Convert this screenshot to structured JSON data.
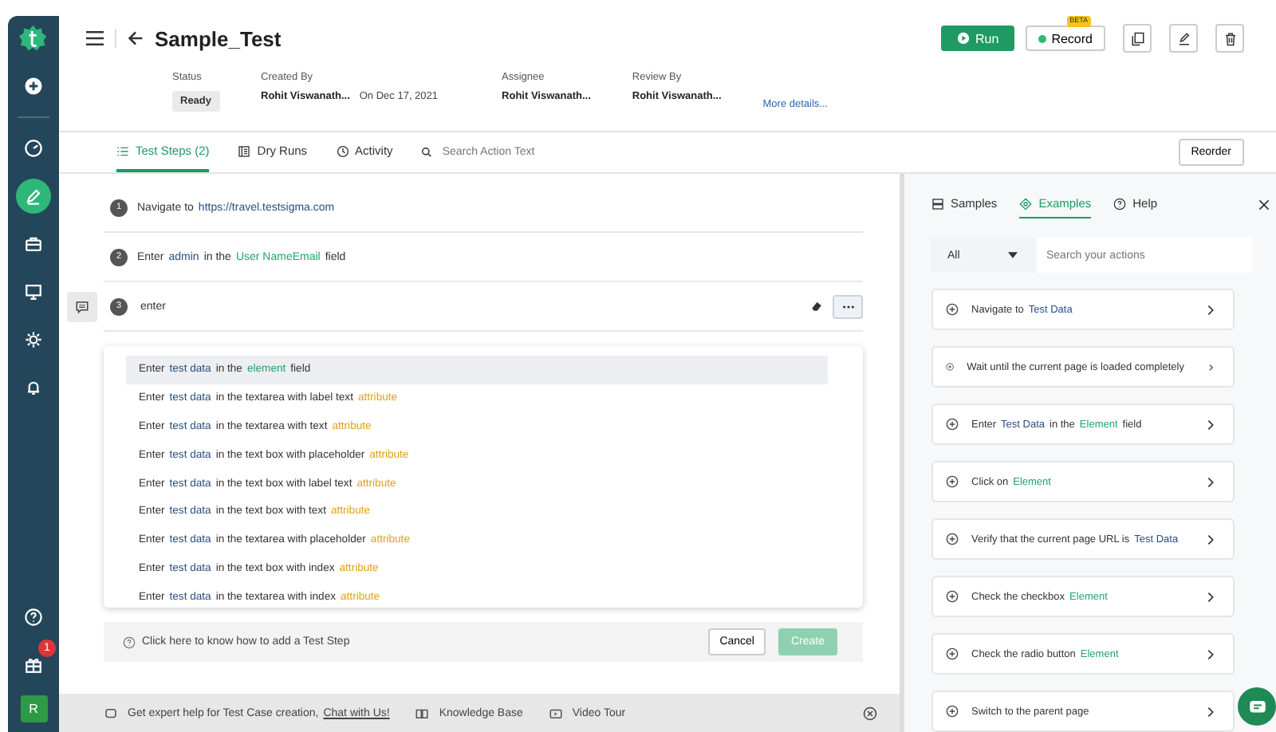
{
  "sidebar": {
    "items": [
      {
        "selected": false
      },
      {
        "selected": false
      },
      {
        "selected": true
      },
      {
        "selected": false
      },
      {
        "selected": false
      },
      {
        "selected": false
      },
      {
        "selected": false
      }
    ],
    "bottom_items": [
      {
        "selected": false
      },
      {
        "selected": false,
        "badge": "1"
      }
    ],
    "avatar": "R"
  },
  "header": {
    "title": "Sample_Test",
    "meta": [
      {
        "label": "Status",
        "value": "Ready",
        "kind": "badge"
      },
      {
        "label": "Created By",
        "value": "Rohit Viswanath...",
        "extra": "On Dec 17, 2021",
        "kind": "text"
      },
      {
        "label": "Assignee",
        "value": "Rohit Viswanath...",
        "kind": "text"
      },
      {
        "label": "Review By",
        "value": "Rohit Viswanath...",
        "kind": "text"
      }
    ],
    "more_link": "More details...",
    "run": "Run",
    "record": "Record",
    "record_badge": "BETA"
  },
  "tabs": [
    {
      "label": "Test Steps (2)",
      "selected": true
    },
    {
      "label": "Dry Runs",
      "selected": false
    },
    {
      "label": "Activity",
      "selected": false
    }
  ],
  "search": {
    "placeholder": "Search Action Text"
  },
  "reorder": "Reorder",
  "steps": [
    {
      "number": "1",
      "kind": "step",
      "parts": [
        {
          "text": "Navigate to",
          "kind": "plain"
        },
        {
          "text": "https://travel.testsigma.com",
          "kind": "data"
        }
      ]
    },
    {
      "number": "2",
      "kind": "step",
      "parts": [
        {
          "text": "Enter",
          "kind": "plain"
        },
        {
          "text": "admin",
          "kind": "data"
        },
        {
          "text": "in the",
          "kind": "plain"
        },
        {
          "text": "User NameEmail",
          "kind": "element"
        },
        {
          "text": "field",
          "kind": "plain"
        }
      ]
    },
    {
      "number": "3",
      "kind": "editing",
      "value": "enter"
    }
  ],
  "suggestions": [
    {
      "selected": true,
      "parts": [
        {
          "text": "Enter",
          "kind": "plain"
        },
        {
          "text": "test data",
          "kind": "data"
        },
        {
          "text": "in the",
          "kind": "plain"
        },
        {
          "text": "element",
          "kind": "element"
        },
        {
          "text": "field",
          "kind": "plain"
        }
      ]
    },
    {
      "selected": false,
      "parts": [
        {
          "text": "Enter",
          "kind": "plain"
        },
        {
          "text": "test data",
          "kind": "data"
        },
        {
          "text": "in the textarea with label text",
          "kind": "plain"
        },
        {
          "text": "attribute",
          "kind": "attribute"
        }
      ]
    },
    {
      "selected": false,
      "parts": [
        {
          "text": "Enter",
          "kind": "plain"
        },
        {
          "text": "test data",
          "kind": "data"
        },
        {
          "text": "in the textarea with text",
          "kind": "plain"
        },
        {
          "text": "attribute",
          "kind": "attribute"
        }
      ]
    },
    {
      "selected": false,
      "parts": [
        {
          "text": "Enter",
          "kind": "plain"
        },
        {
          "text": "test data",
          "kind": "data"
        },
        {
          "text": "in the text box with placeholder",
          "kind": "plain"
        },
        {
          "text": "attribute",
          "kind": "attribute"
        }
      ]
    },
    {
      "selected": false,
      "parts": [
        {
          "text": "Enter",
          "kind": "plain"
        },
        {
          "text": "test data",
          "kind": "data"
        },
        {
          "text": "in the text box with label text",
          "kind": "plain"
        },
        {
          "text": "attribute",
          "kind": "attribute"
        }
      ]
    },
    {
      "selected": false,
      "parts": [
        {
          "text": "Enter",
          "kind": "plain"
        },
        {
          "text": "test data",
          "kind": "data"
        },
        {
          "text": "in the text box with text",
          "kind": "plain"
        },
        {
          "text": "attribute",
          "kind": "attribute"
        }
      ]
    },
    {
      "selected": false,
      "parts": [
        {
          "text": "Enter",
          "kind": "plain"
        },
        {
          "text": "test data",
          "kind": "data"
        },
        {
          "text": "in the textarea with placeholder",
          "kind": "plain"
        },
        {
          "text": "attribute",
          "kind": "attribute"
        }
      ]
    },
    {
      "selected": false,
      "parts": [
        {
          "text": "Enter",
          "kind": "plain"
        },
        {
          "text": "test data",
          "kind": "data"
        },
        {
          "text": "in the text box with index",
          "kind": "plain"
        },
        {
          "text": "attribute",
          "kind": "attribute"
        }
      ]
    },
    {
      "selected": false,
      "parts": [
        {
          "text": "Enter",
          "kind": "plain"
        },
        {
          "text": "test data",
          "kind": "data"
        },
        {
          "text": "in the textarea with index",
          "kind": "plain"
        },
        {
          "text": "attribute",
          "kind": "attribute"
        }
      ]
    }
  ],
  "footer": {
    "help": "Click here to know how to add a Test Step",
    "cancel": "Cancel",
    "create": "Create",
    "create_disabled": true
  },
  "bottom_bar": {
    "text": "Get expert help for Test Case creation,",
    "link": "Chat with Us!",
    "knowledge": "Knowledge Base",
    "video": "Video Tour"
  },
  "panel": {
    "tabs": [
      {
        "label": "Samples",
        "selected": false
      },
      {
        "label": "Examples",
        "selected": true
      },
      {
        "label": "Help",
        "selected": false
      }
    ],
    "filter": "All",
    "search_placeholder": "Search your actions",
    "examples": [
      {
        "parts": [
          {
            "text": "Navigate to",
            "kind": "plain"
          },
          {
            "text": "Test Data",
            "kind": "data"
          }
        ]
      },
      {
        "parts": [
          {
            "text": "Wait until the current page is loaded completely",
            "kind": "plain"
          }
        ]
      },
      {
        "parts": [
          {
            "text": "Enter",
            "kind": "plain"
          },
          {
            "text": "Test Data",
            "kind": "data"
          },
          {
            "text": "in the",
            "kind": "plain"
          },
          {
            "text": "Element",
            "kind": "element"
          },
          {
            "text": "field",
            "kind": "plain"
          }
        ]
      },
      {
        "parts": [
          {
            "text": "Click on",
            "kind": "plain"
          },
          {
            "text": "Element",
            "kind": "element"
          }
        ]
      },
      {
        "parts": [
          {
            "text": "Verify that the current page URL is",
            "kind": "plain"
          },
          {
            "text": "Test Data",
            "kind": "data"
          }
        ]
      },
      {
        "parts": [
          {
            "text": "Check the checkbox",
            "kind": "plain"
          },
          {
            "text": "Element",
            "kind": "element"
          }
        ]
      },
      {
        "parts": [
          {
            "text": "Check the radio button",
            "kind": "plain"
          },
          {
            "text": "Element",
            "kind": "element"
          }
        ]
      },
      {
        "parts": [
          {
            "text": "Switch to the parent page",
            "kind": "plain"
          }
        ]
      }
    ]
  }
}
